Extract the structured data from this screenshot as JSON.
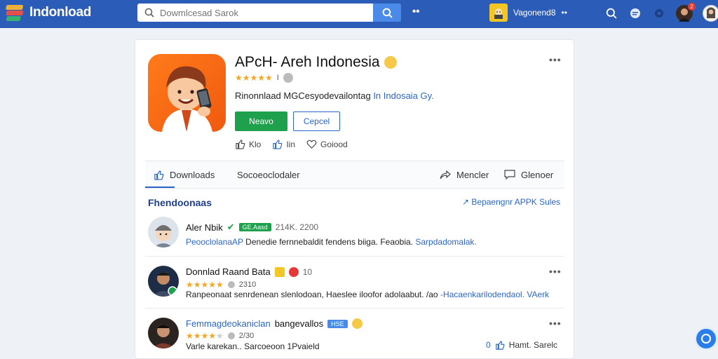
{
  "brand": {
    "name": "Indonload",
    "colors": {
      "topbar": "#2b5db8",
      "accent": "#2a66c9",
      "green": "#1ea04c"
    }
  },
  "search": {
    "placeholder": "Dowmlcesad Sarok",
    "icon": "search-icon"
  },
  "topbar": {
    "dots": "••",
    "user_name": "Vagonend8",
    "user_dots": "••",
    "notification_count": "2",
    "icons": [
      "search-icon",
      "chat-icon",
      "settings-icon"
    ]
  },
  "app": {
    "title": "APcH- Areh Indonesia",
    "rating_text": "I",
    "description_main": "Rinonnlaad MGCesyodevailontag",
    "description_link": "In Indosaia",
    "description_tail": "Gy.",
    "install_label": "Neavo",
    "cancel_label": "Cepcel",
    "actions": [
      {
        "label": "Klo",
        "icon": "thumbs-up-icon"
      },
      {
        "label": "Iin",
        "icon": "thumbs-up-icon"
      },
      {
        "label": "Goiood",
        "icon": "heart-icon"
      }
    ]
  },
  "tabs": [
    {
      "label": "Downloads",
      "icon": "thumbs-up-icon"
    },
    {
      "label": "Socoeoclodaler"
    },
    {
      "label": "Mencler",
      "icon": "share-icon"
    },
    {
      "label": "Glenoer",
      "icon": "comment-icon"
    }
  ],
  "reviews_section": {
    "title": "Fhendoonaas",
    "link": "Bepaengnr APPK Sules"
  },
  "reviews": [
    {
      "name": "Aler Nbik",
      "tag": "GE.Aasd",
      "meta": "214K. 2200",
      "text_link": "PeooclolanaAP",
      "text": " Denedie fernnebaldit fendens biiga. Feaobia.",
      "text_link2": "Sarpdadomalak."
    },
    {
      "name": "Donnlad Raand Bata",
      "tag_count": "10",
      "meta": "2310",
      "text": "Ranpeonaat senrdenean slenlodoan, Haeslee iloofor adolaabut. /ao",
      "text_link": "-Hacaenkarilodendaol. VAerk"
    },
    {
      "name": "Femmagdeokaniclan",
      "name_tail": "bangevallos",
      "tag": "HSE",
      "meta": "2/30",
      "text": "Varle karekan.. Sarcoeoon 1Pvaield",
      "action_count": "0",
      "action_label": "Hamt. Sarelc"
    }
  ]
}
